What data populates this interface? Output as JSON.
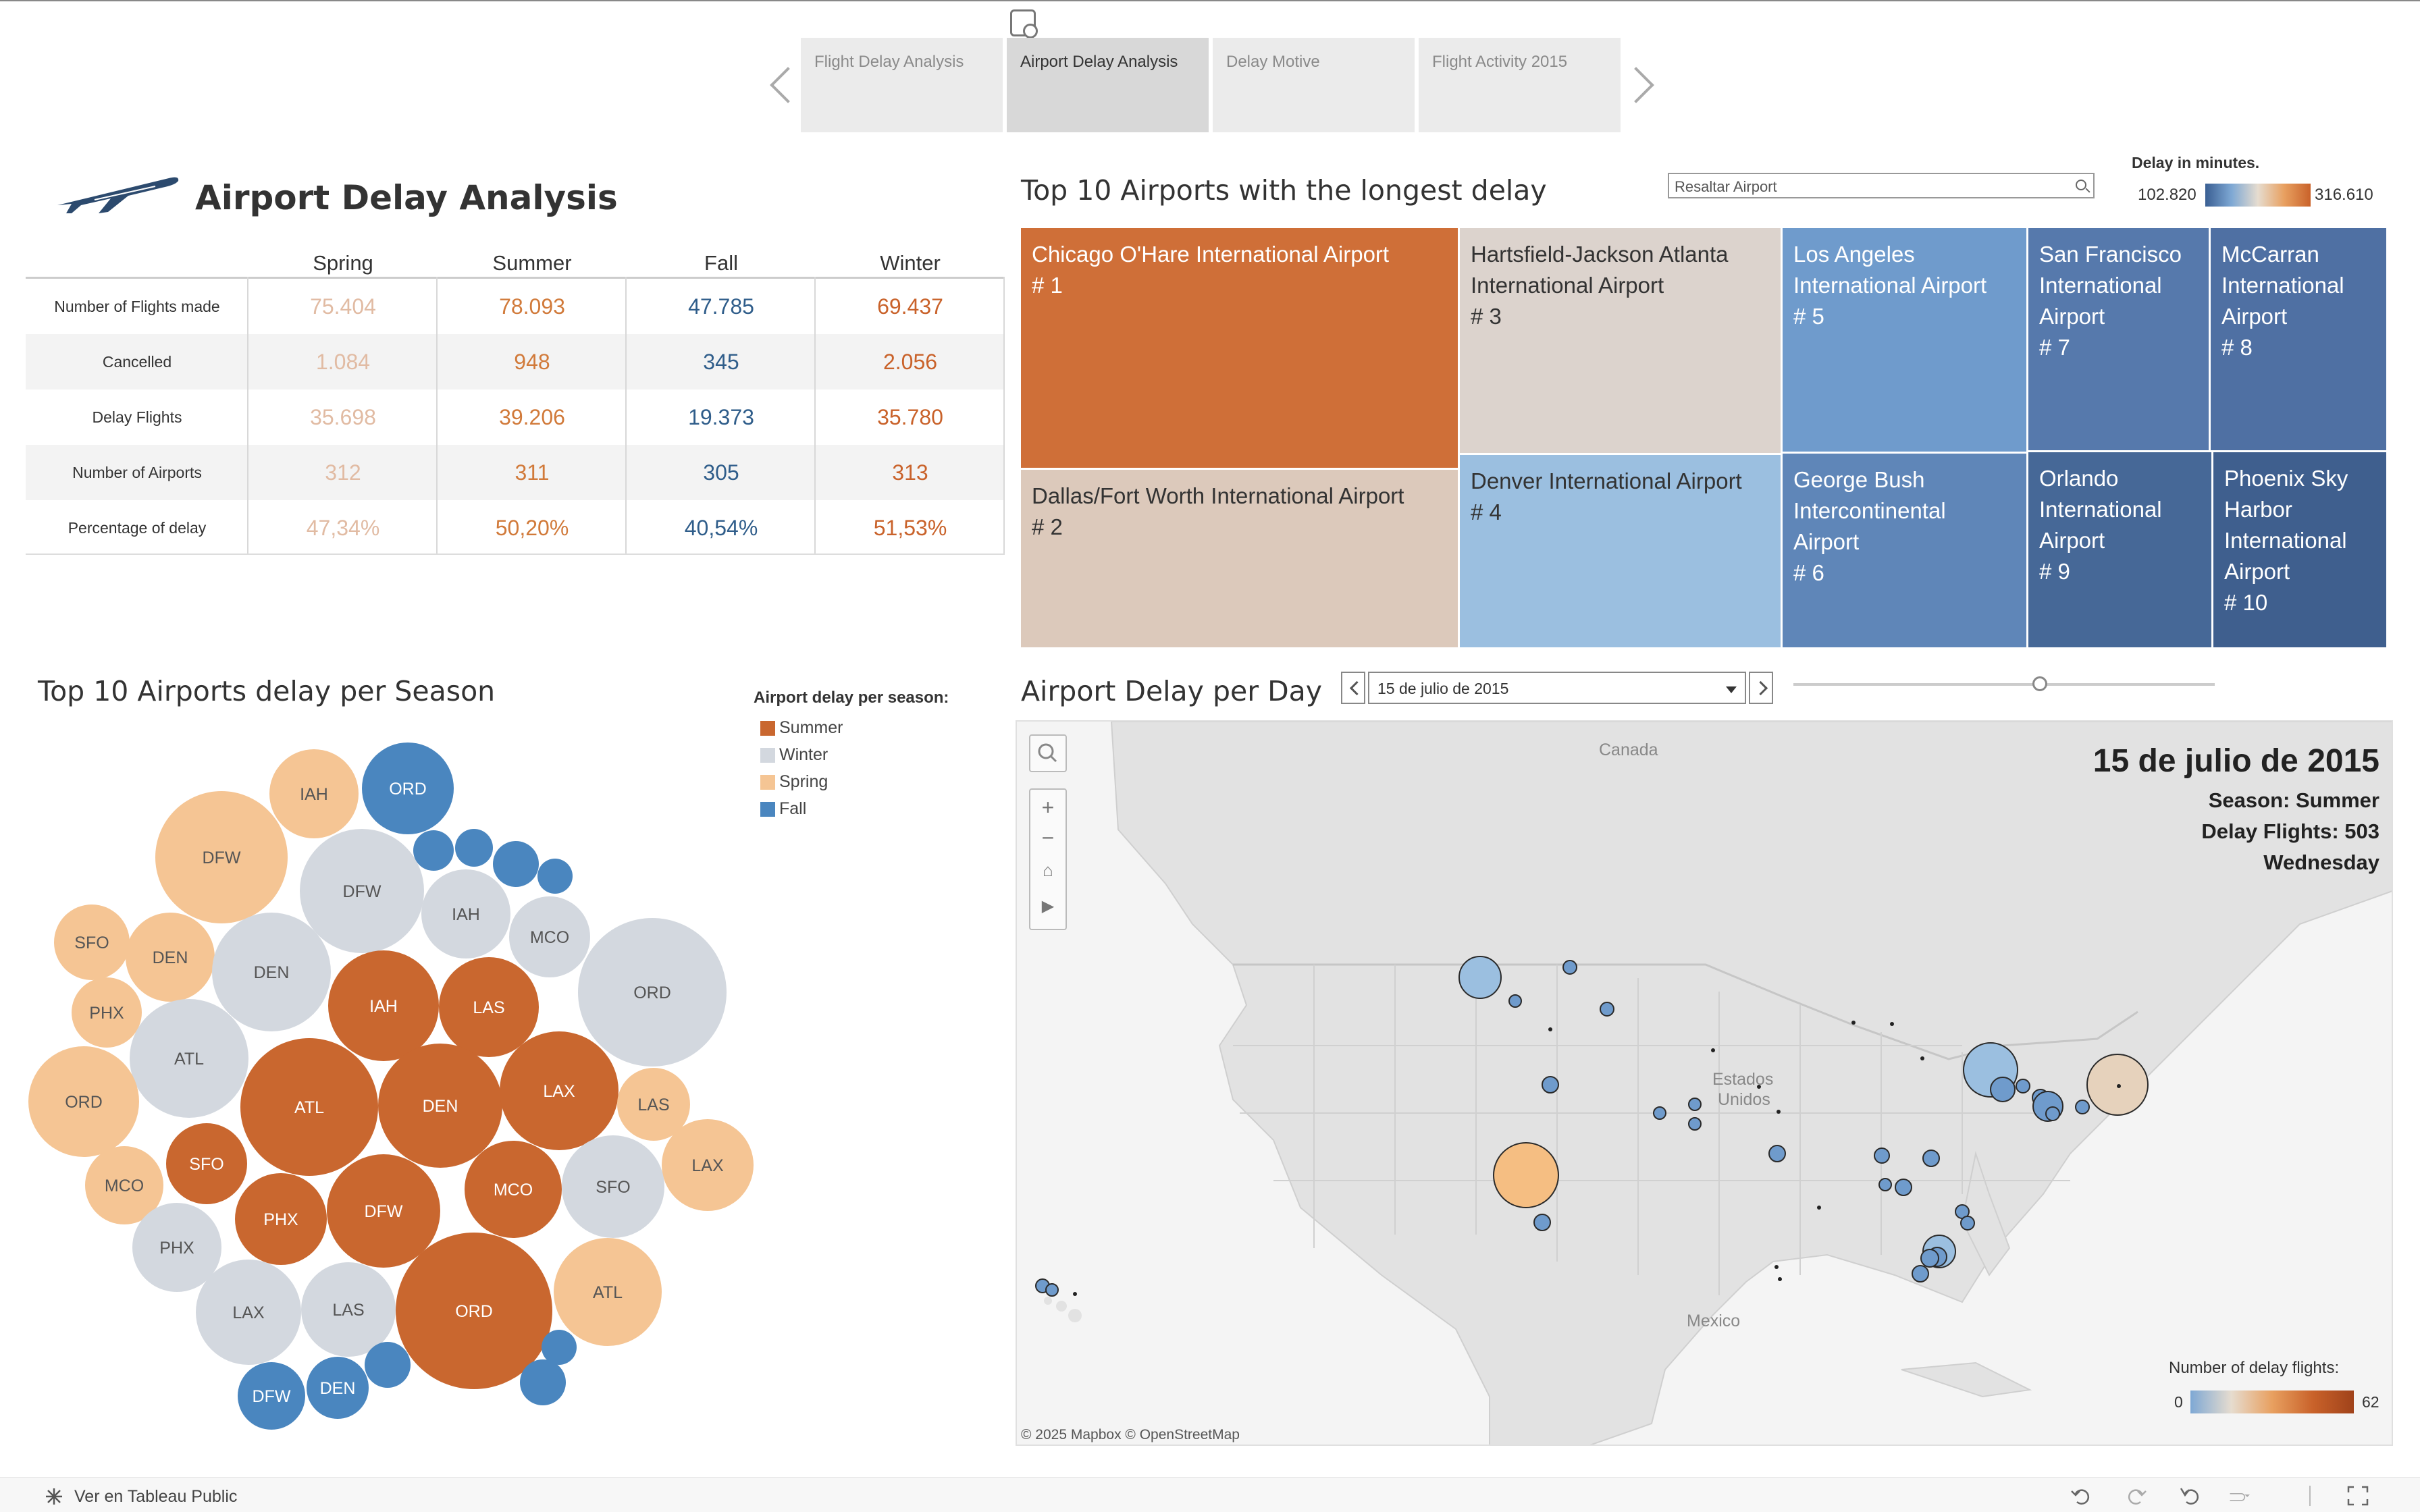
{
  "story": {
    "tabs": [
      {
        "label": "Flight Delay Analysis",
        "active": false
      },
      {
        "label": "Airport Delay Analysis",
        "active": true
      },
      {
        "label": "Delay Motive",
        "active": false
      },
      {
        "label": "Flight Activity 2015",
        "active": false
      }
    ]
  },
  "header": {
    "title": "Airport Delay Analysis"
  },
  "stats_table": {
    "columns": [
      "Spring",
      "Summer",
      "Fall",
      "Winter"
    ],
    "column_colors": [
      "#e1bba3",
      "#d17a3a",
      "#2f5d8a",
      "#c9622a"
    ],
    "rows": [
      {
        "label": "Number of Flights made",
        "values": [
          "75.404",
          "78.093",
          "47.785",
          "69.437"
        ]
      },
      {
        "label": "Cancelled",
        "values": [
          "1.084",
          "948",
          "345",
          "2.056"
        ]
      },
      {
        "label": "Delay Flights",
        "values": [
          "35.698",
          "39.206",
          "19.373",
          "35.780"
        ]
      },
      {
        "label": "Number of Airports",
        "values": [
          "312",
          "311",
          "305",
          "313"
        ]
      },
      {
        "label": "Percentage of delay",
        "values": [
          "47,34%",
          "50,20%",
          "40,54%",
          "51,53%"
        ]
      }
    ]
  },
  "treemap": {
    "title": "Top 10 Airports with the longest delay",
    "search_placeholder": "Resaltar Airport",
    "legend_title": "Delay in minutes.",
    "legend_min": "102.820",
    "legend_max": "316.610",
    "cells": [
      {
        "name": "Chicago O'Hare International Airport",
        "rank": "# 1",
        "color": "#cf6f38",
        "dark": false
      },
      {
        "name": "Dallas/Fort Worth International Airport",
        "rank": "# 2",
        "color": "#dcc9bb",
        "dark": true
      },
      {
        "name": "Hartsfield-Jackson Atlanta International Airport",
        "rank": "# 3",
        "color": "#dcd3cd",
        "dark": true
      },
      {
        "name": "Denver International Airport",
        "rank": "# 4",
        "color": "#9bbfe0",
        "dark": true
      },
      {
        "name": "Los Angeles International Airport",
        "rank": "# 5",
        "color": "#6f9bcc",
        "dark": false
      },
      {
        "name": "George Bush Intercontinental Airport",
        "rank": "# 6",
        "color": "#5f86b8",
        "dark": false
      },
      {
        "name": "San Francisco International Airport",
        "rank": "# 7",
        "color": "#5679ac",
        "dark": false
      },
      {
        "name": "McCarran International Airport",
        "rank": "# 8",
        "color": "#4f70a3",
        "dark": false
      },
      {
        "name": "Orlando International Airport",
        "rank": "# 9",
        "color": "#466897",
        "dark": false
      },
      {
        "name": "Phoenix Sky Harbor International Airport",
        "rank": "# 10",
        "color": "#3f5f8e",
        "dark": false
      }
    ]
  },
  "bubble_chart": {
    "title": "Top 10 Airports delay per Season",
    "legend_title": "Airport delay per season:",
    "legend": [
      {
        "label": "Summer",
        "color": "#c9672f"
      },
      {
        "label": "Winter",
        "color": "#d3d8df"
      },
      {
        "label": "Spring",
        "color": "#f5c594"
      },
      {
        "label": "Fall",
        "color": "#4a86bf"
      }
    ]
  },
  "map": {
    "title": "Airport Delay per Day",
    "selected_date": "15 de julio de 2015",
    "overlay_date": "15 de julio de 2015",
    "season_line": "Season:  Summer",
    "delay_line": "Delay Flights: 503",
    "weekday": "Wednesday",
    "label_canada": "Canada",
    "label_us_1": "Estados",
    "label_us_2": "Unidos",
    "label_mexico": "Mexico",
    "attribution": "© 2025 Mapbox  © OpenStreetMap",
    "legend_title": "Number of delay flights:",
    "legend_min": "0",
    "legend_max": "62"
  },
  "footer": {
    "link_text": "Ver en Tableau Public"
  }
}
